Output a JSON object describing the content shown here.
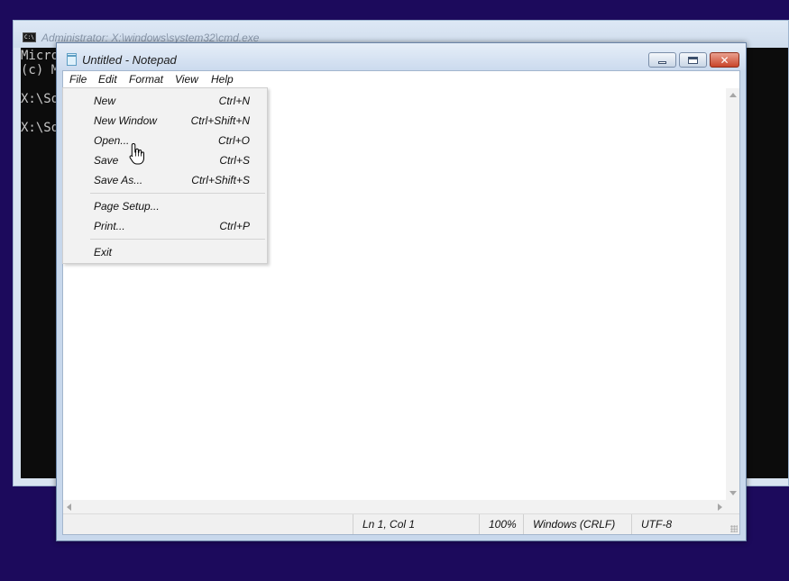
{
  "cmd_window": {
    "title": "Administrator: X:\\windows\\system32\\cmd.exe",
    "icon": "console-icon",
    "lines": [
      "Micro",
      "(c) M",
      "",
      "X:\\So",
      "",
      "X:\\So"
    ]
  },
  "notepad": {
    "title": "Untitled - Notepad",
    "icon": "notepad-icon",
    "menubar": [
      "File",
      "Edit",
      "Format",
      "View",
      "Help"
    ],
    "editor_text": "",
    "status": {
      "position": "Ln 1, Col 1",
      "zoom": "100%",
      "line_endings": "Windows (CRLF)",
      "encoding": "UTF-8"
    }
  },
  "file_menu": {
    "items": [
      {
        "label": "New",
        "shortcut": "Ctrl+N"
      },
      {
        "label": "New Window",
        "shortcut": "Ctrl+Shift+N"
      },
      {
        "label": "Open...",
        "shortcut": "Ctrl+O"
      },
      {
        "label": "Save",
        "shortcut": "Ctrl+S"
      },
      {
        "label": "Save As...",
        "shortcut": "Ctrl+Shift+S"
      },
      {
        "label": "Page Setup...",
        "shortcut": ""
      },
      {
        "label": "Print...",
        "shortcut": "Ctrl+P"
      },
      {
        "label": "Exit",
        "shortcut": ""
      }
    ],
    "hovered": "Open..."
  },
  "colors": {
    "desktop": "#1c0a5c",
    "console_bg": "#0c0c0c",
    "console_text": "#c7c7c7",
    "close_button": "#c9452a"
  }
}
